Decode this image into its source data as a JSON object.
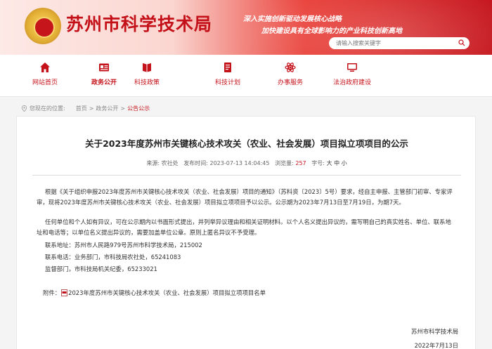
{
  "header": {
    "site_title": "苏州市科学技术局",
    "slogan_line1": "深入实施创新驱动发展核心战略",
    "slogan_line2": "加快建设具有全球影响力的产业科技创新高地",
    "search_placeholder": "请输入搜索关键字"
  },
  "nav": {
    "items": [
      {
        "label": "网站首页",
        "icon": "home-icon"
      },
      {
        "label": "政务公开",
        "icon": "news-icon",
        "active": true
      },
      {
        "label": "科技政策",
        "icon": "book-icon"
      },
      {
        "label": "科技计划",
        "icon": "document-icon"
      },
      {
        "label": "办事服务",
        "icon": "atom-icon"
      },
      {
        "label": "法治政府建设",
        "icon": "monitor-icon"
      }
    ]
  },
  "breadcrumb": {
    "prefix": "您现在的位置:",
    "home": "首页",
    "sep": ">",
    "section": "政务公开",
    "current": "公告公示"
  },
  "article": {
    "title": "关于2023年度苏州市关键核心技术攻关（农业、社会发展）项目拟立项项目的公示",
    "meta_source": "来源: 农社处",
    "meta_time": "发布时间: 2023-07-13 14:04:45",
    "meta_views_label": "浏览量:",
    "meta_views": "257",
    "meta_fontsize_label": "字号:",
    "fs_large": "大",
    "fs_medium": "中",
    "fs_small": "小",
    "para1": "根据《关于组织申报2023年度苏州市关键核心技术攻关（农业、社会发展）项目的通知》（苏科资〔2023〕5号）要求，经自主申报、主管部门初审、专家评审，现将2023年度苏州市关键核心技术攻关（农业、社会发展）项目拟立项项目予以公示。公示期为2023年7月13日至7月19日，为期7天。",
    "para2": "任何单位和个人如有异议，可在公示期内以书面形式提出，并列举异议理由和相关证明材料。以个人名义提出异议的，需写明自己的真实姓名、单位、联系地址和电话等；以单位名义提出异议的，需要加盖单位公章。原则上匿名异议不予受理。",
    "contact_address": "联系地址：苏州市人民路979号苏州市科学技术局，215002",
    "contact_phone": "联系电话：业务部门，市科技局农社处，65241083",
    "supervisor": "监督部门，市科技局机关纪委，65233021",
    "attachment_label": "附件：",
    "attachment_name": "2023年度苏州市关键核心技术攻关（农业、社会发展）项目拟立项项目名单",
    "signature_org": "苏州市科学技术局",
    "signature_date": "2022年7月13日"
  },
  "colors": {
    "brand_red": "#c4121a",
    "header_gradient_start": "#fde9e6",
    "header_gradient_end": "#c5151d"
  }
}
